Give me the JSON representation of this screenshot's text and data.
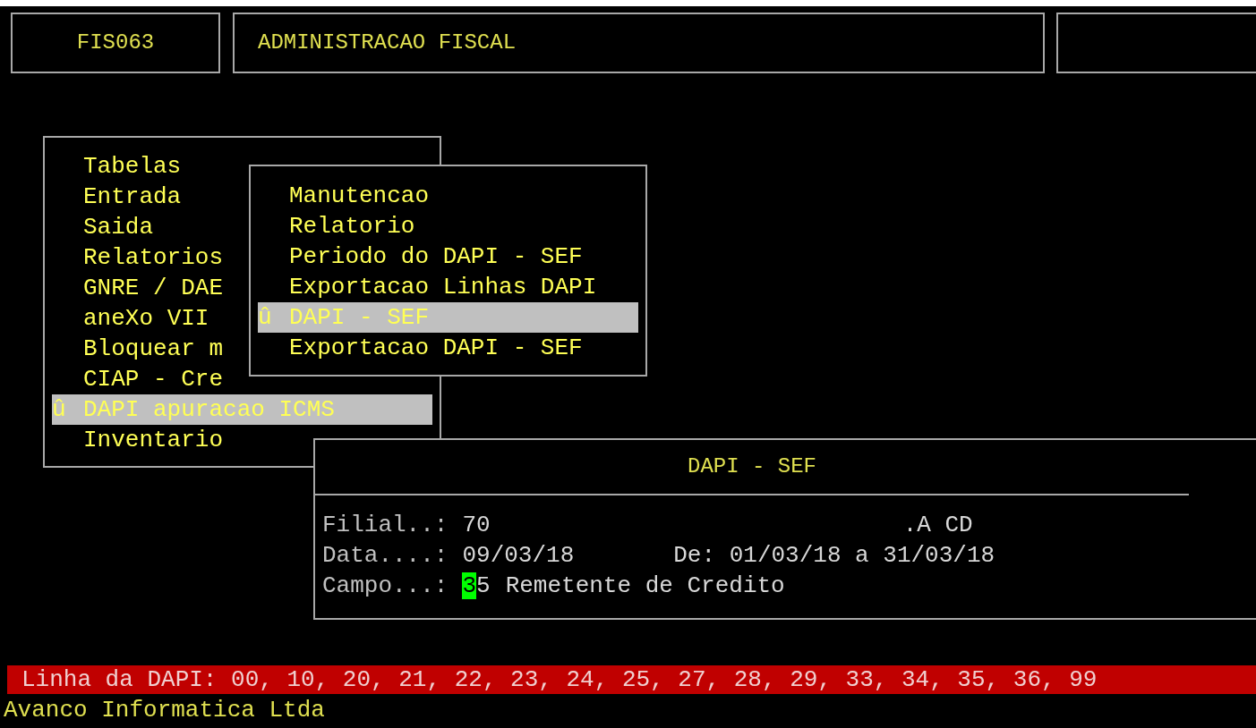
{
  "header": {
    "program_code": "FIS063",
    "title": "ADMINISTRACAO FISCAL"
  },
  "main_menu": {
    "items": [
      {
        "label": "**T**abelas",
        "selected": false
      },
      {
        "label": "**E**ntrada",
        "selected": false
      },
      {
        "label": "**S**aida",
        "selected": false
      },
      {
        "label": "**R**elatorios",
        "selected": false
      },
      {
        "label": "G**N**RE / DAE",
        "selected": false
      },
      {
        "label": "ane**X**o VII",
        "selected": false
      },
      {
        "label": "**B**loquear m",
        "selected": false
      },
      {
        "label": "**C**IAP - Cre",
        "selected": false
      },
      {
        "label": "DAPI apuracao ICMS",
        "marker": "û",
        "selected": true
      },
      {
        "label": "**I**nventario",
        "selected": false
      }
    ]
  },
  "submenu": {
    "items": [
      {
        "label": "**M**anutencao",
        "selected": false
      },
      {
        "label": "**R**elatorio",
        "selected": false
      },
      {
        "label": "**P**eriodo do DAPI - SEF",
        "selected": false
      },
      {
        "label": "Exportacao **L**inhas DAPI",
        "selected": false
      },
      {
        "label": "DAPI - SEF",
        "marker": "û",
        "selected": true
      },
      {
        "label": "**E**xportacao DAPI - SEF",
        "selected": false
      }
    ]
  },
  "dialog": {
    "title": "DAPI - SEF",
    "fields": [
      {
        "label": "Filial..:",
        "value": "70",
        "cursor": false,
        "extra": ".A CD"
      },
      {
        "label": "Data....:",
        "value": "09/03/18",
        "cursor": false,
        "extra": "De: 01/03/18 a 31/03/18"
      },
      {
        "label": "Campo...:",
        "value": "35",
        "cursor": true,
        "extra": "Remetente de Credito"
      }
    ]
  },
  "status_bar": "Linha da DAPI: 00, 10, 20, 21, 22, 23, 24, 25, 27, 28, 29, 33, 34, 35, 36, 99",
  "footer": "Avanco Informatica Ltda"
}
